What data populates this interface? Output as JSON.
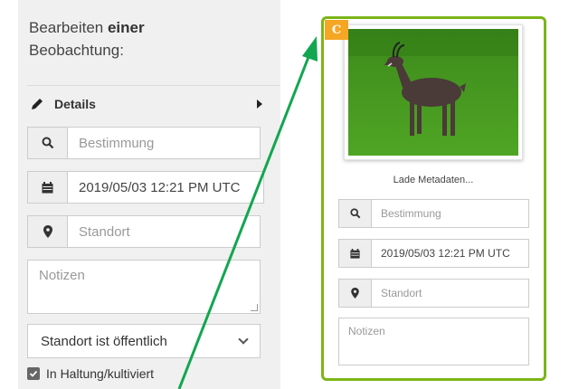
{
  "left": {
    "heading_normal": "Bearbeiten ",
    "heading_bold": "einer",
    "heading_line2": "Beobachtung:",
    "details_label": "Details",
    "fields": {
      "species_placeholder": "Bestimmung",
      "date_value": "2019/05/03 12:21 PM UTC",
      "location_placeholder": "Standort",
      "notes_placeholder": "Notizen"
    },
    "visibility_select": "Standort ist öffentlich",
    "captive_label": "In Haltung/kultiviert",
    "captive_checked": true
  },
  "card": {
    "badge_letter": "C",
    "metadata_status": "Lade Metadaten...",
    "species_placeholder": "Bestimmung",
    "date_value": "2019/05/03 12:21 PM UTC",
    "location_placeholder": "Standort",
    "notes_placeholder": "Notizen",
    "border_color": "#7cb518",
    "badge_color": "#f5a623"
  },
  "annotation": {
    "arrow_color": "#12a650"
  },
  "icons": {
    "details": "pencil-icon",
    "species": "search-icon",
    "date": "calendar-icon",
    "location": "map-marker-icon",
    "expand": "caret-right-icon",
    "select": "chevron-down-icon"
  }
}
